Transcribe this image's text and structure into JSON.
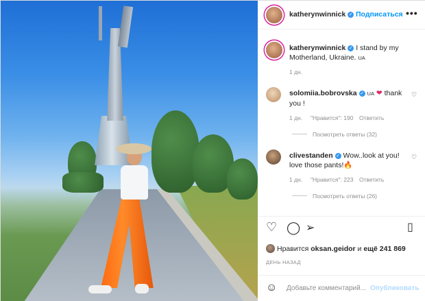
{
  "post": {
    "username": "katherynwinnick",
    "follow_label": "Подписаться",
    "more_label": "•••",
    "caption": "I stand by my Motherland, Ukraine.",
    "caption_flag": "UA",
    "caption_time": "1 дн."
  },
  "comments": [
    {
      "username": "solomiia.bobrovska",
      "flag": "UA",
      "text": "thank you !",
      "time": "1 дн.",
      "likes": "\"Нравится\": 190",
      "reply_label": "Ответить",
      "view_replies": "Посмотреть ответы (32)"
    },
    {
      "username": "clivestanden",
      "text": "Wow..look at you! love those pants!🔥",
      "time": "1 дн.",
      "likes": "\"Нравится\": 223",
      "reply_label": "Ответить",
      "view_replies": "Посмотреть ответы (26)"
    }
  ],
  "likes_line": {
    "prefix": "Нравится",
    "user": "oksan.geidor",
    "middle": "и",
    "rest": "ещё 241 869"
  },
  "date_label": "ДЕНЬ НАЗАД",
  "add_comment": {
    "placeholder": "Добавьте комментарий...",
    "publish_label": "Опубликовать"
  }
}
